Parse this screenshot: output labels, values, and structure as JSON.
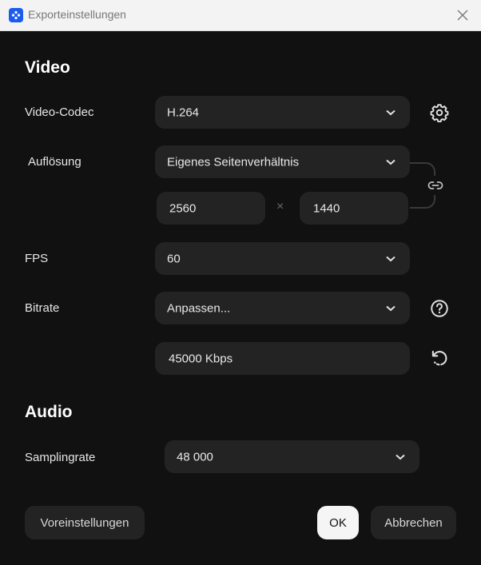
{
  "window": {
    "title": "Exporteinstellungen"
  },
  "video": {
    "heading": "Video",
    "codec_label": "Video-Codec",
    "codec_value": "H.264",
    "resolution_label": "Auflösung",
    "resolution_value": "Eigenes Seitenverhältnis",
    "width_value": "2560",
    "times_symbol": "×",
    "height_value": "1440",
    "fps_label": "FPS",
    "fps_value": "60",
    "bitrate_label": "Bitrate",
    "bitrate_mode_value": "Anpassen...",
    "bitrate_value": "45000 Kbps"
  },
  "audio": {
    "heading": "Audio",
    "samplerate_label": "Samplingrate",
    "samplerate_value": "48 000"
  },
  "footer": {
    "presets_label": "Voreinstellungen",
    "ok_label": "OK",
    "cancel_label": "Abbrechen"
  },
  "icons": {
    "app": "app-logo-icon",
    "close": "close-icon",
    "settings": "gear-icon",
    "link": "link-icon",
    "help": "question-circle-icon",
    "reset": "reset-icon",
    "dropdown": "chevron-down-icon"
  },
  "colors": {
    "background": "#111111",
    "field": "#232323",
    "titlebar": "#f3f3f3",
    "app_icon": "#1a5cf0",
    "ok_button": "#f5f5f5"
  }
}
